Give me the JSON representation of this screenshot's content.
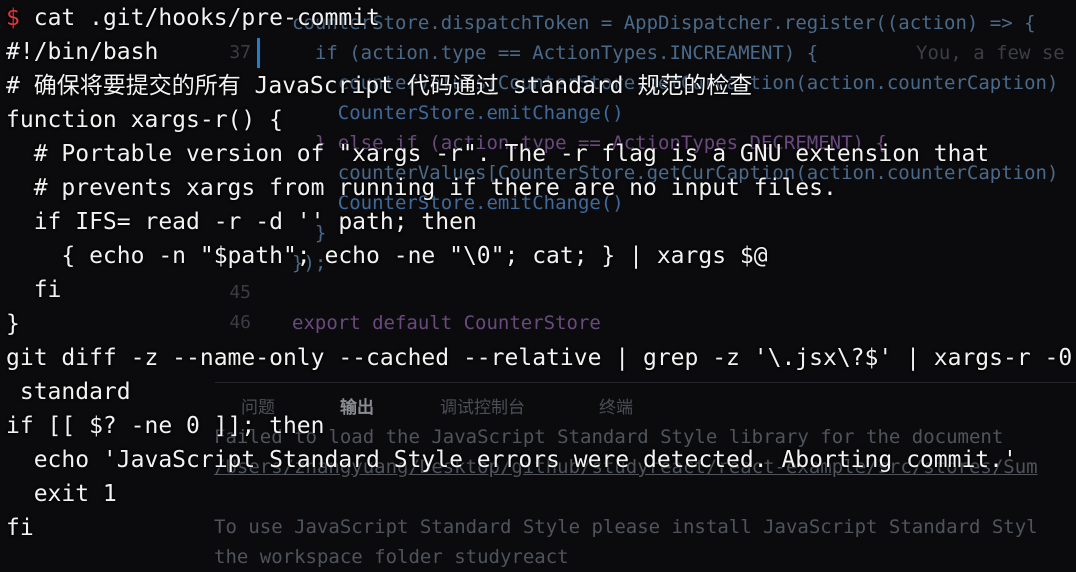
{
  "editor": {
    "line_numbers": [
      "37",
      "45",
      "46"
    ],
    "code_lines": [
      "counterStore.dispatchToken = AppDispatcher.register((action) => {",
      "  if (action.type == ActionTypes.INCREAMENT) {",
      "    counterValues[CounterStore.getCurCaption(action.counterCaption)",
      "    CounterStore.emitChange()",
      "  } else if (action.type == ActionTypes.DECREMENT) {",
      "    counterValues[CounterStore.getCurCaption(action.counterCaption)",
      "    CounterStore.emitChange()",
      "  }",
      "});",
      "",
      "export default CounterStore"
    ],
    "ghost_text": "You, a few se"
  },
  "panel": {
    "tabs": [
      {
        "label": "问题",
        "active": false
      },
      {
        "label": "输出",
        "active": true
      },
      {
        "label": "调试控制台",
        "active": false
      },
      {
        "label": "终端",
        "active": false
      }
    ],
    "output_lines": [
      "Failed to load the JavaScript Standard Style library for the document",
      "/Users/zhangyuang/Desktop/github/studyreact/react-example/src/stores/Sum",
      "",
      "To use JavaScript Standard Style please install JavaScript Standard Styl",
      "the workspace folder studyreact"
    ]
  },
  "terminal": {
    "prompt_symbol": "$",
    "command": "cat .git/hooks/pre-commit",
    "lines": [
      "#!/bin/bash",
      "# 确保将要提交的所有 JavaScript 代码通过 standard 规范的检查",
      "function xargs-r() {",
      "  # Portable version of \"xargs -r\". The -r flag is a GNU extension that",
      "  # prevents xargs from running if there are no input files.",
      "  if IFS= read -r -d '' path; then",
      "    { echo -n \"$path\"; echo -ne \"\\0\"; cat; } | xargs $@",
      "  fi",
      "}",
      "git diff -z --name-only --cached --relative | grep -z '\\.jsx\\?$' | xargs-r -0",
      " standard",
      "if [[ $? -ne 0 ]]; then",
      "  echo 'JavaScript Standard Style errors were detected. Aborting commit.'",
      "  exit 1",
      "fi"
    ]
  }
}
